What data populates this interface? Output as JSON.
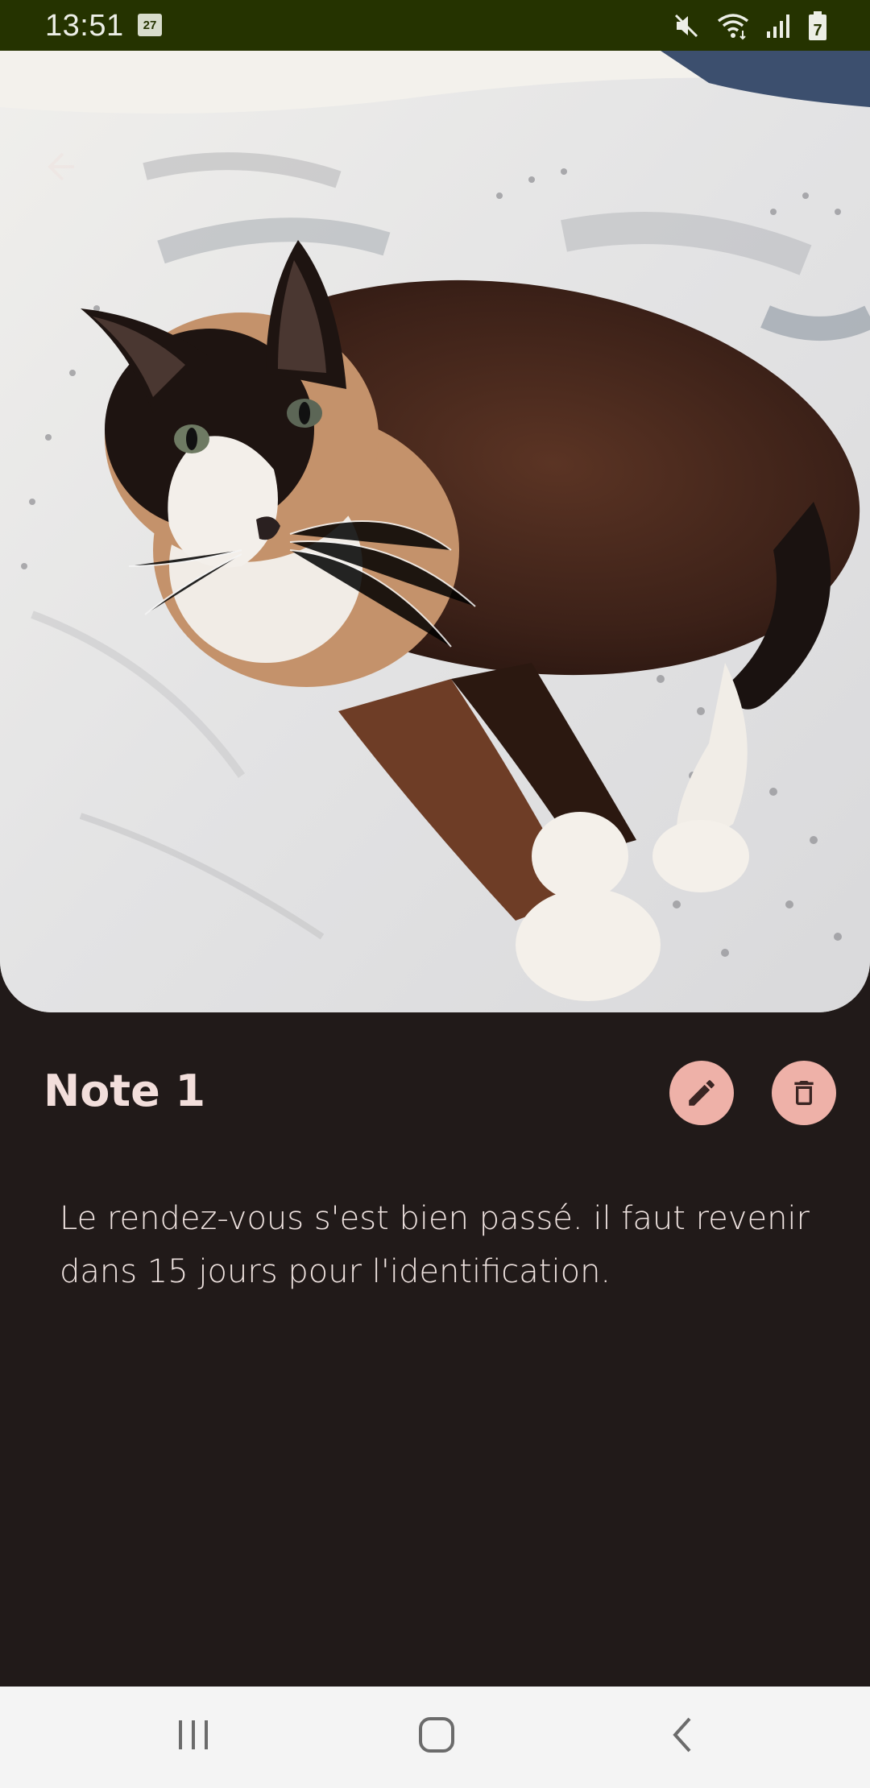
{
  "status_bar": {
    "time": "13:51",
    "calendar_day": "27",
    "icons": [
      "calendar-icon",
      "mute-icon",
      "wifi-icon",
      "signal-icon",
      "battery-icon"
    ],
    "battery_level": "7"
  },
  "photo": {
    "description_icon": "cat-photo",
    "back_icon": "back-arrow-icon"
  },
  "note": {
    "title": "Note 1",
    "body": "Le rendez-vous s'est bien passé. il faut revenir dans 15 jours pour l'identification."
  },
  "actions": {
    "edit_icon": "pencil-icon",
    "delete_icon": "trash-icon"
  },
  "nav_bar": {
    "items": [
      "recents-icon",
      "home-icon",
      "back-icon"
    ]
  },
  "colors": {
    "status_bar_bg": "#253300",
    "page_bg": "#211a19",
    "button_bg": "#eeb1a8",
    "nav_bg": "#f4f4f4"
  }
}
